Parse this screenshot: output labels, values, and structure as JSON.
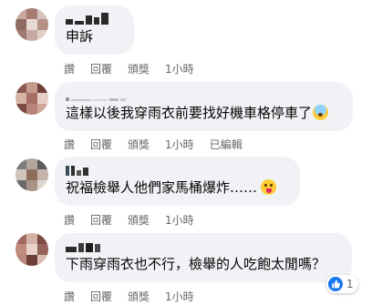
{
  "comments": [
    {
      "text": "申訴",
      "actions": {
        "like": "讚",
        "reply": "回覆",
        "share": "頒獎",
        "time": "1小時",
        "edited": ""
      },
      "avatar_colors": [
        "#c9a8a0",
        "#a77c72",
        "#d7c3bd",
        "#8d6b62",
        "#e6d8d2",
        "#b59087",
        "#9e7a73",
        "#c7aaa1",
        "#e1cfc8"
      ]
    },
    {
      "text": "這樣以後我穿雨衣前要找好機車格停車了",
      "emoji": "anxious-face",
      "actions": {
        "like": "讚",
        "reply": "回覆",
        "share": "頒獎",
        "time": "1小時",
        "edited": "已編輯"
      },
      "avatar_colors": [
        "#8a5a52",
        "#c49a8c",
        "#6e4038",
        "#d8b4a6",
        "#a86f64",
        "#e6cfc6",
        "#7c4c44",
        "#b88478",
        "#cfa79a"
      ]
    },
    {
      "text": "祝福檢舉人他們家馬桶爆炸……",
      "emoji": "zany-face",
      "actions": {
        "like": "讚",
        "reply": "回覆",
        "share": "頒獎",
        "time": "1小時",
        "edited": ""
      },
      "avatar_colors": [
        "#7d7d7d",
        "#b6a79c",
        "#5b5b5b",
        "#d2c6bc",
        "#8e6f5d",
        "#c4b5aa",
        "#6a6a6a",
        "#a89486",
        "#e0d6ce"
      ]
    },
    {
      "text": "下雨穿雨衣也不行，檢舉的人吃飽太閒嗎？",
      "actions": {
        "like": "讚",
        "reply": "回覆",
        "share": "頒獎",
        "time": "1小時",
        "edited": ""
      },
      "avatar_colors": [
        "#a06a5e",
        "#d6b2a6",
        "#7c4a40",
        "#c08a7c",
        "#e8d2ca",
        "#94635a",
        "#b98b80",
        "#6d3f36",
        "#dcbfb4"
      ],
      "reaction": {
        "type": "like",
        "count": "1"
      }
    }
  ],
  "colors": {
    "bubble": "#f0f2f5",
    "meta_text": "#65676b",
    "like_blue": "#1877f2"
  }
}
